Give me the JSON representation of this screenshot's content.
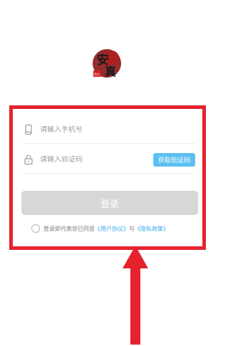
{
  "login": {
    "phone_placeholder": "请输入手机号",
    "code_placeholder": "请输入验证码",
    "get_code_label": "获取验证码",
    "login_label": "登录",
    "agreement_prefix": "登录即代表您已同意",
    "user_agreement": "《用户协议》",
    "and": "与",
    "privacy_policy": "《隐私政策》"
  },
  "logo": {
    "char1": "安",
    "char2": "真",
    "seal": "官方"
  },
  "colors": {
    "frame_red": "#e5222e",
    "accent_blue": "#5bc0f0",
    "link_blue": "#3aa8e8",
    "disabled_gray": "#d7d7d7"
  }
}
